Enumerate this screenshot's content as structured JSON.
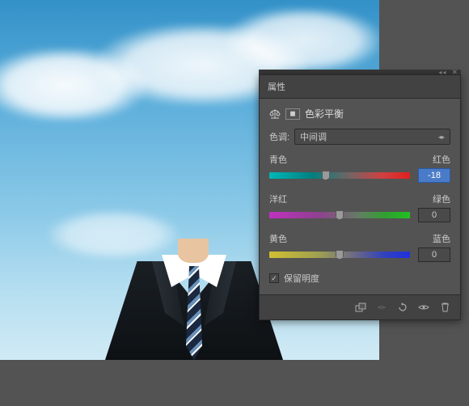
{
  "panel": {
    "tab_title": "属性",
    "title": "色彩平衡",
    "tone_label": "色调:",
    "tone_value": "中间调",
    "sliders": [
      {
        "left": "青色",
        "right": "红色",
        "value": "-18",
        "pos": 40,
        "selected": true
      },
      {
        "left": "洋红",
        "right": "绿色",
        "value": "0",
        "pos": 50,
        "selected": false
      },
      {
        "left": "黄色",
        "right": "蓝色",
        "value": "0",
        "pos": 50,
        "selected": false
      }
    ],
    "preserve_lum": "保留明度",
    "preserve_checked": true
  }
}
